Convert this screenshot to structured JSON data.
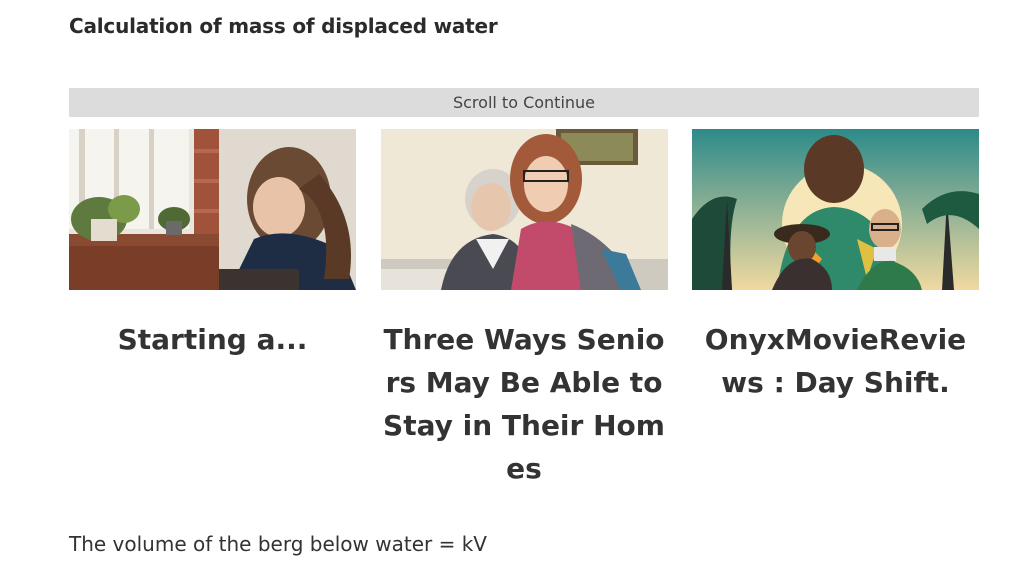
{
  "article": {
    "heading": "Calculation of mass of displaced water",
    "body_line": "The volume of the berg below water = kV"
  },
  "ad_unit": {
    "scroll_label": "Scroll to Continue",
    "cards": [
      {
        "title": "Starting a...",
        "image": "woman-writing-at-window-photo"
      },
      {
        "title": "Three Ways Seniors May Be Able to Stay in Their Homes",
        "image": "senior-and-young-woman-photo"
      },
      {
        "title": "OnyxMovieReviews : Day Shift.",
        "image": "day-shift-movie-poster"
      }
    ]
  }
}
